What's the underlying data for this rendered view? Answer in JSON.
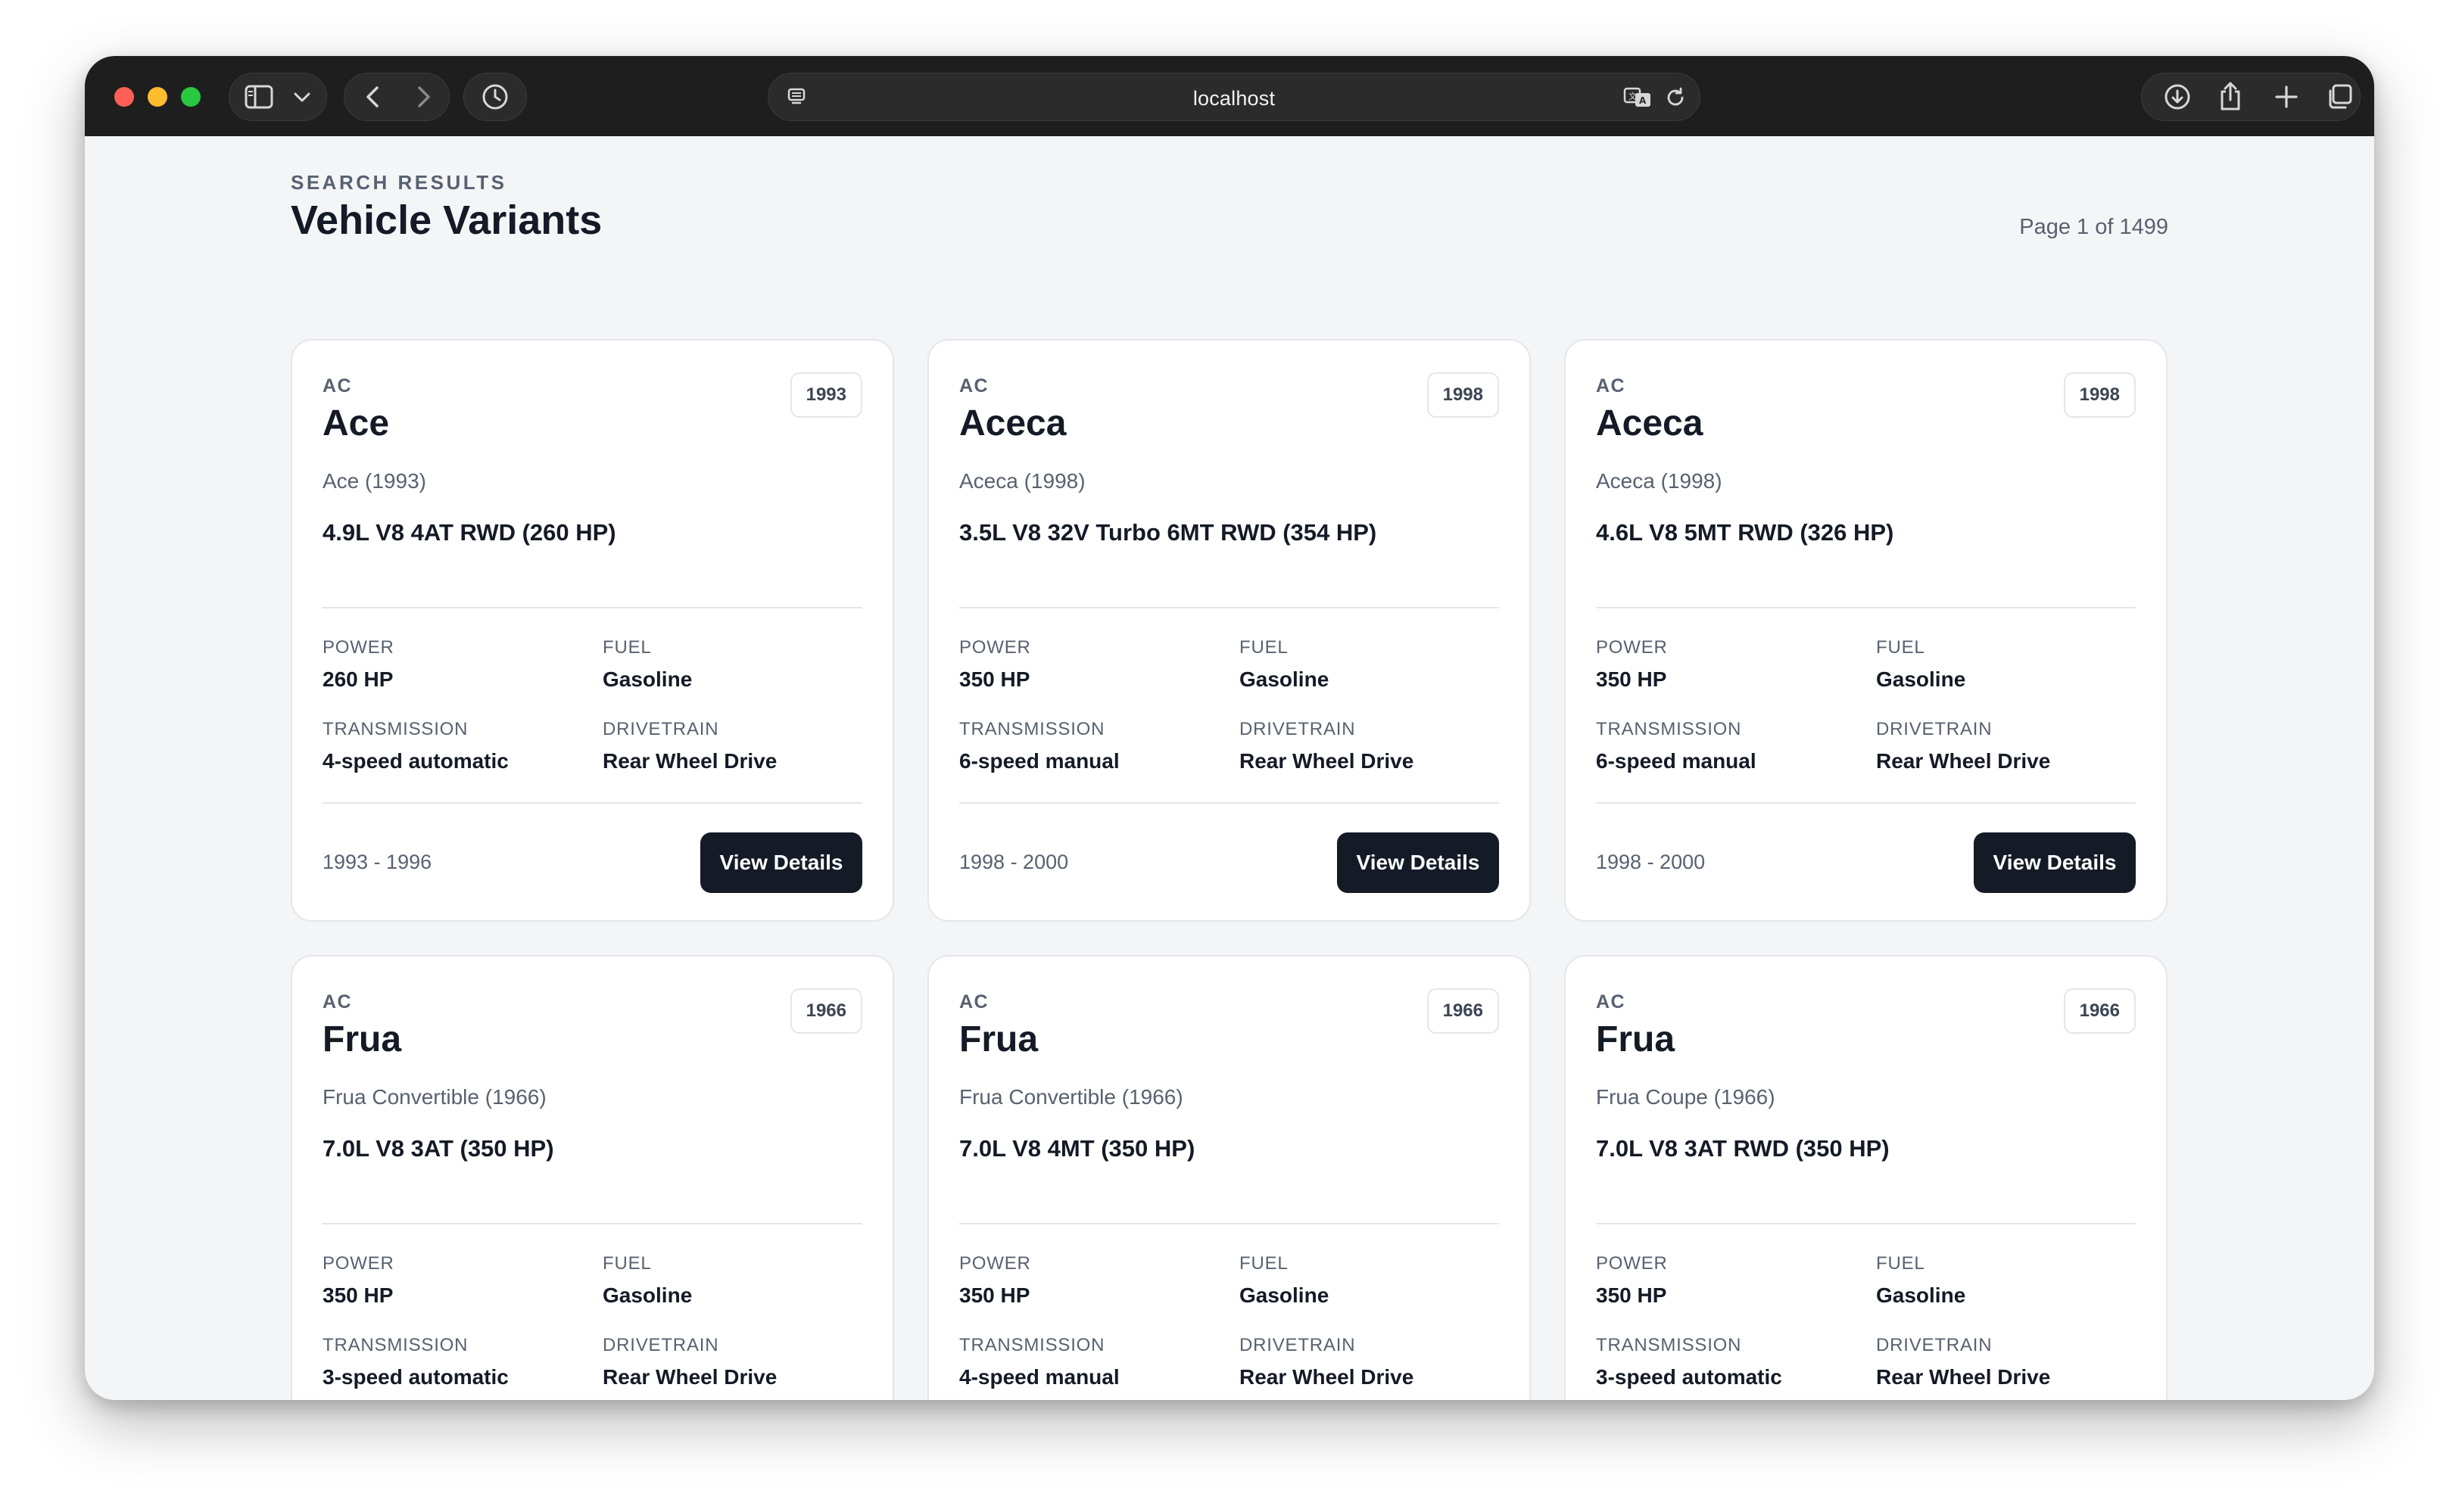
{
  "browser": {
    "address": "localhost"
  },
  "header": {
    "eyebrow": "SEARCH RESULTS",
    "title": "Vehicle Variants",
    "page_indicator": "Page 1 of 1499"
  },
  "labels": {
    "power": "POWER",
    "fuel": "FUEL",
    "transmission": "TRANSMISSION",
    "drivetrain": "DRIVETRAIN",
    "button": "View Details"
  },
  "cards": [
    {
      "brand": "AC",
      "model": "Ace",
      "year": "1993",
      "subtitle": "Ace (1993)",
      "engine": "4.9L V8 4AT RWD (260 HP)",
      "power": "260 HP",
      "fuel": "Gasoline",
      "transmission": "4-speed automatic",
      "drivetrain": "Rear Wheel Drive",
      "years": "1993 - 1996"
    },
    {
      "brand": "AC",
      "model": "Aceca",
      "year": "1998",
      "subtitle": "Aceca (1998)",
      "engine": "3.5L V8 32V Turbo 6MT RWD (354 HP)",
      "power": "350 HP",
      "fuel": "Gasoline",
      "transmission": "6-speed manual",
      "drivetrain": "Rear Wheel Drive",
      "years": "1998 - 2000"
    },
    {
      "brand": "AC",
      "model": "Aceca",
      "year": "1998",
      "subtitle": "Aceca (1998)",
      "engine": "4.6L V8 5MT RWD (326 HP)",
      "power": "350 HP",
      "fuel": "Gasoline",
      "transmission": "6-speed manual",
      "drivetrain": "Rear Wheel Drive",
      "years": "1998 - 2000"
    },
    {
      "brand": "AC",
      "model": "Frua",
      "year": "1966",
      "subtitle": "Frua Convertible (1966)",
      "engine": "7.0L V8 3AT (350 HP)",
      "power": "350 HP",
      "fuel": "Gasoline",
      "transmission": "3-speed automatic",
      "drivetrain": "Rear Wheel Drive",
      "years": ""
    },
    {
      "brand": "AC",
      "model": "Frua",
      "year": "1966",
      "subtitle": "Frua Convertible (1966)",
      "engine": "7.0L V8 4MT (350 HP)",
      "power": "350 HP",
      "fuel": "Gasoline",
      "transmission": "4-speed manual",
      "drivetrain": "Rear Wheel Drive",
      "years": ""
    },
    {
      "brand": "AC",
      "model": "Frua",
      "year": "1966",
      "subtitle": "Frua Coupe (1966)",
      "engine": "7.0L V8 3AT RWD (350 HP)",
      "power": "350 HP",
      "fuel": "Gasoline",
      "transmission": "3-speed automatic",
      "drivetrain": "Rear Wheel Drive",
      "years": ""
    }
  ]
}
